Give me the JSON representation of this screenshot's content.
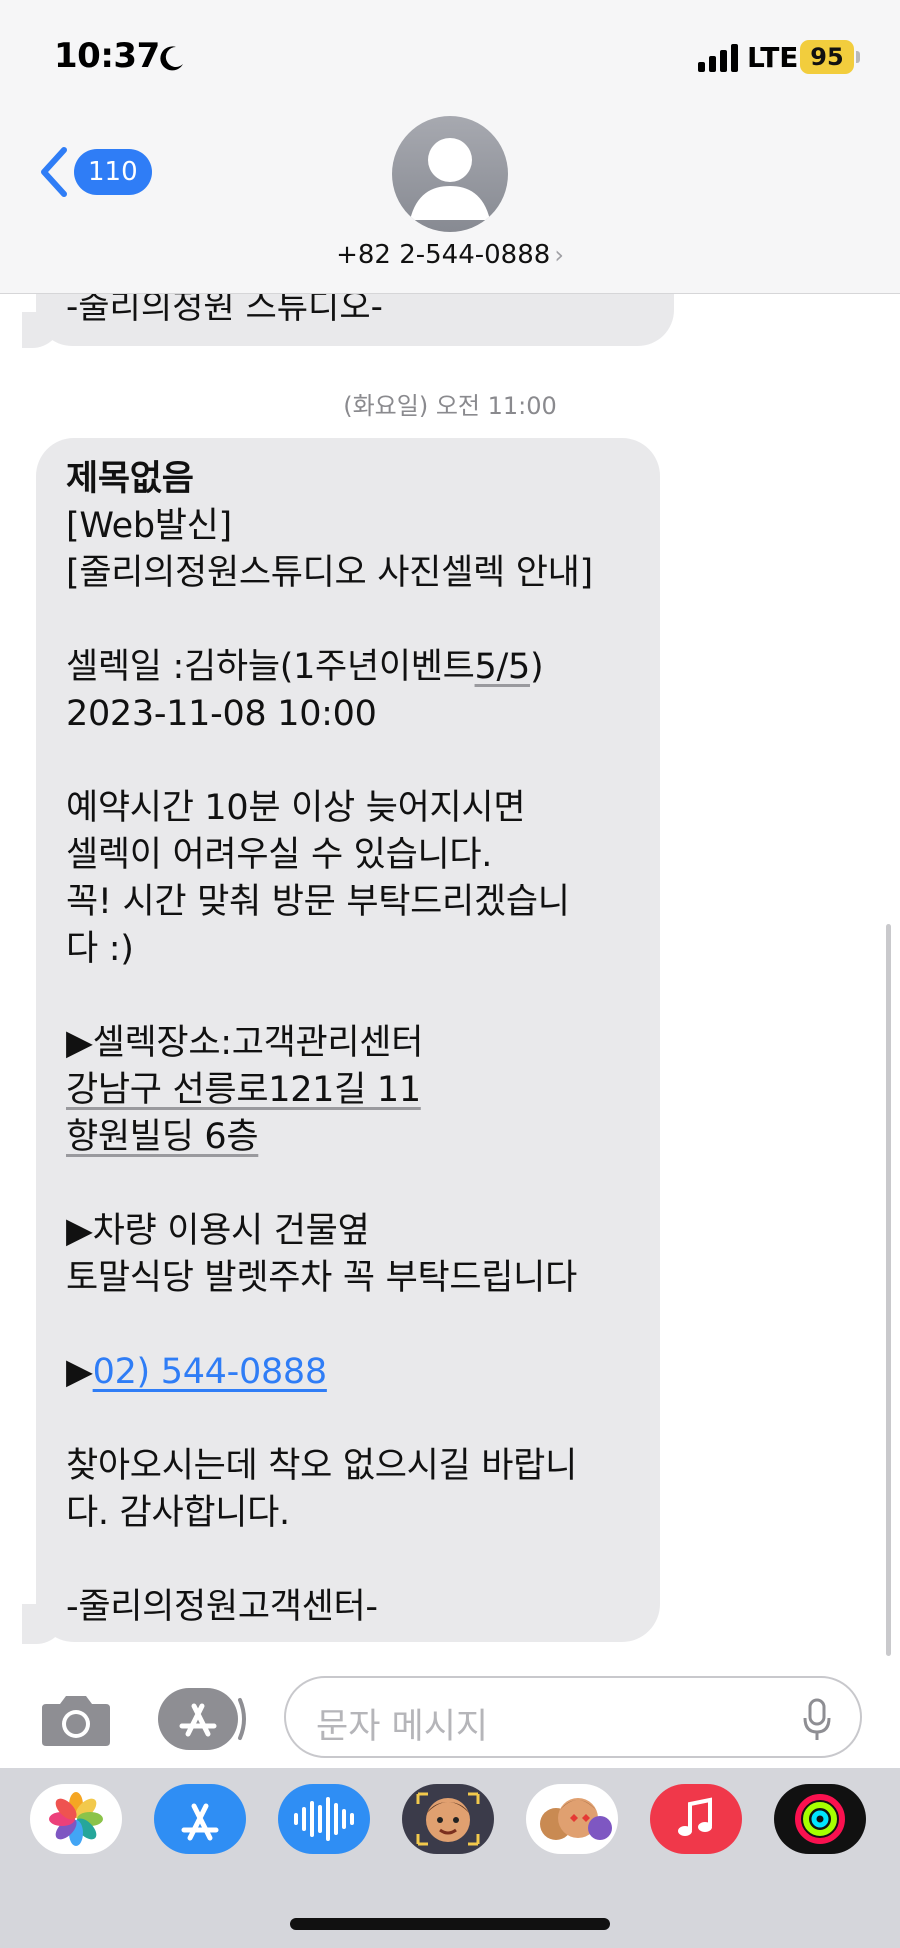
{
  "status_bar": {
    "time": "10:37",
    "network": "LTE",
    "battery": "95"
  },
  "header": {
    "back_count": "110",
    "contact": "+82 2-544-0888",
    "contact_chevron": "›"
  },
  "conversation": {
    "previous_message_tail": "-줄리의정원 스튜디오-",
    "timestamp": "(화요일) 오전 11:00",
    "message": {
      "title": "제목없음",
      "lines": [
        "[Web발신]",
        "[줄리의정원스튜디오 사진셀렉 안내]",
        "",
        "셀렉일 :김하늘(1주년이벤트5/5)",
        "2023-11-08 10:00",
        "",
        "예약시간 10분 이상 늦어지시면",
        "셀렉이 어려우실 수 있습니다.",
        "꼭! 시간 맞춰 방문 부탁드리겠습니",
        "다 :)",
        "",
        "▶셀렉장소:고객관리센터",
        "강남구 선릉로121길 11",
        "향원빌딩 6층",
        "",
        "▶차량 이용시 건물옆",
        "토말식당 발렛주차 꼭 부탁드립니다",
        ""
      ],
      "phone_prefix": "▶",
      "phone_link": "02) 544-0888",
      "closing_lines": [
        "",
        "찾아오시는데 착오 없으시길 바랍니",
        "다. 감사합니다.",
        "",
        "-줄리의정원고객센터-"
      ]
    }
  },
  "compose": {
    "placeholder": "문자 메시지"
  },
  "app_drawer": {
    "apps": [
      "photos-app",
      "app-store-app",
      "audio-message-app",
      "memoji-app",
      "animoji-stickers-app",
      "music-app",
      "activity-app"
    ]
  },
  "colors": {
    "accent": "#2f7df6",
    "bubble": "#e9e9eb",
    "battery": "#f2cd3d"
  }
}
